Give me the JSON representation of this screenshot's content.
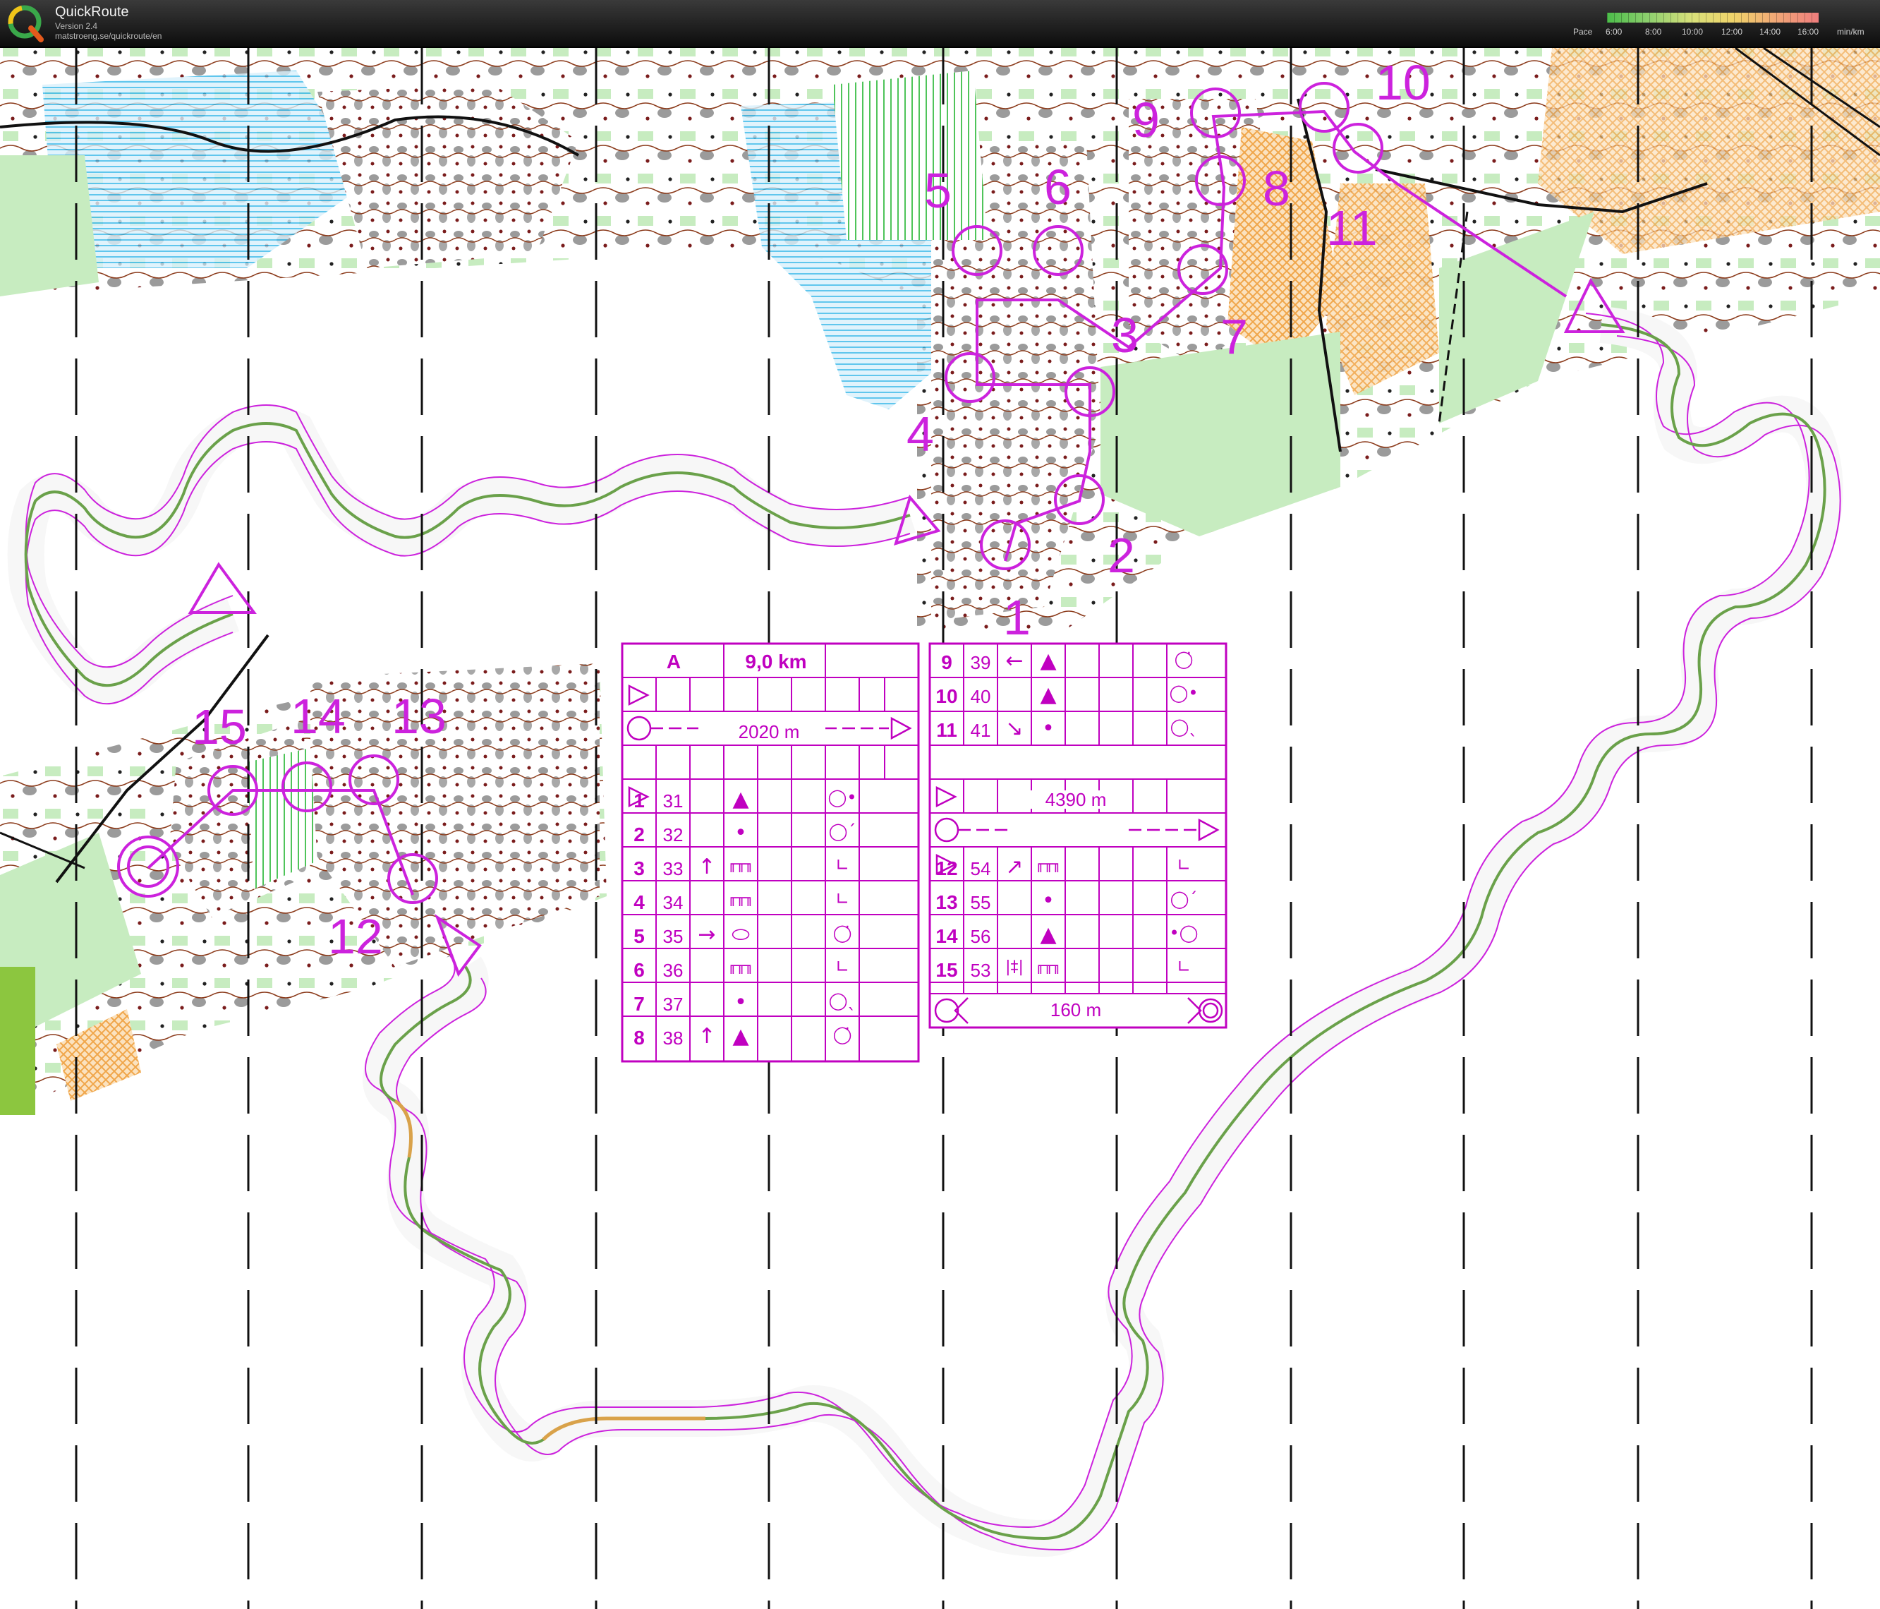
{
  "app": {
    "title": "QuickRoute",
    "version": "Version 2.4",
    "url": "matstroeng.se/quickroute/en"
  },
  "pace_legend": {
    "label": "Pace",
    "ticks": [
      "6:00",
      "8:00",
      "10:00",
      "12:00",
      "14:00",
      "16:00"
    ],
    "unit": "min/km",
    "colors": [
      "#4cbd4a",
      "#8fd06f",
      "#d8e07a",
      "#f0d36a",
      "#f1a777",
      "#ef7d7d"
    ]
  },
  "course": {
    "class": "A",
    "length": "9,0 km",
    "marked_route_1": "2020 m",
    "marked_route_2": "4390 m",
    "finish_distance": "160 m"
  },
  "controls": [
    {
      "no": "1",
      "code": "31",
      "dir": "",
      "feature": "▲",
      "appearance": "",
      "position": "◯•"
    },
    {
      "no": "2",
      "code": "32",
      "dir": "",
      "feature": "•",
      "appearance": "",
      "position": "◯´"
    },
    {
      "no": "3",
      "code": "33",
      "dir": "↑",
      "feature": "╓╥╖",
      "appearance": "",
      "position": "∟"
    },
    {
      "no": "4",
      "code": "34",
      "dir": "",
      "feature": "╓╥╖",
      "appearance": "",
      "position": "∟"
    },
    {
      "no": "5",
      "code": "35",
      "dir": "→",
      "feature": "⬭",
      "appearance": "",
      "position": "◯̇"
    },
    {
      "no": "6",
      "code": "36",
      "dir": "",
      "feature": "╓╥╖",
      "appearance": "",
      "position": "∟"
    },
    {
      "no": "7",
      "code": "37",
      "dir": "",
      "feature": "•",
      "appearance": "",
      "position": "◯ˎ"
    },
    {
      "no": "8",
      "code": "38",
      "dir": "↑",
      "feature": "▲",
      "appearance": "",
      "position": "◯̇"
    },
    {
      "no": "9",
      "code": "39",
      "dir": "←",
      "feature": "▲",
      "appearance": "",
      "position": "◯̇"
    },
    {
      "no": "10",
      "code": "40",
      "dir": "",
      "feature": "▲",
      "appearance": "",
      "position": "◯•"
    },
    {
      "no": "11",
      "code": "41",
      "dir": "↘",
      "feature": "•",
      "appearance": "",
      "position": "◯ˎ"
    },
    {
      "no": "12",
      "code": "54",
      "dir": "↗",
      "feature": "╓╥╖",
      "appearance": "",
      "position": "∟"
    },
    {
      "no": "13",
      "code": "55",
      "dir": "",
      "feature": "•",
      "appearance": "",
      "position": "◯ˊ"
    },
    {
      "no": "14",
      "code": "56",
      "dir": "",
      "feature": "▲",
      "appearance": "",
      "position": "•◯"
    },
    {
      "no": "15",
      "code": "53",
      "dir": "|‡|",
      "feature": "╓╥╖",
      "appearance": "",
      "position": "∟"
    }
  ],
  "map_labels": [
    "1",
    "2",
    "3",
    "4",
    "5",
    "6",
    "7",
    "8",
    "9",
    "10",
    "11",
    "12",
    "13",
    "14",
    "15"
  ],
  "colors": {
    "course": "#cc22dd",
    "route_good": "#6aa14a",
    "route_slow": "#d9a24a",
    "forest_open": "#ffffff",
    "green": "#6fd06a",
    "light_green": "#c7ecc0",
    "marsh_blue": "#38b8e8",
    "rock": "#9b9b9b",
    "contour": "#8b3a1a",
    "yellow": "#f4b35c"
  }
}
